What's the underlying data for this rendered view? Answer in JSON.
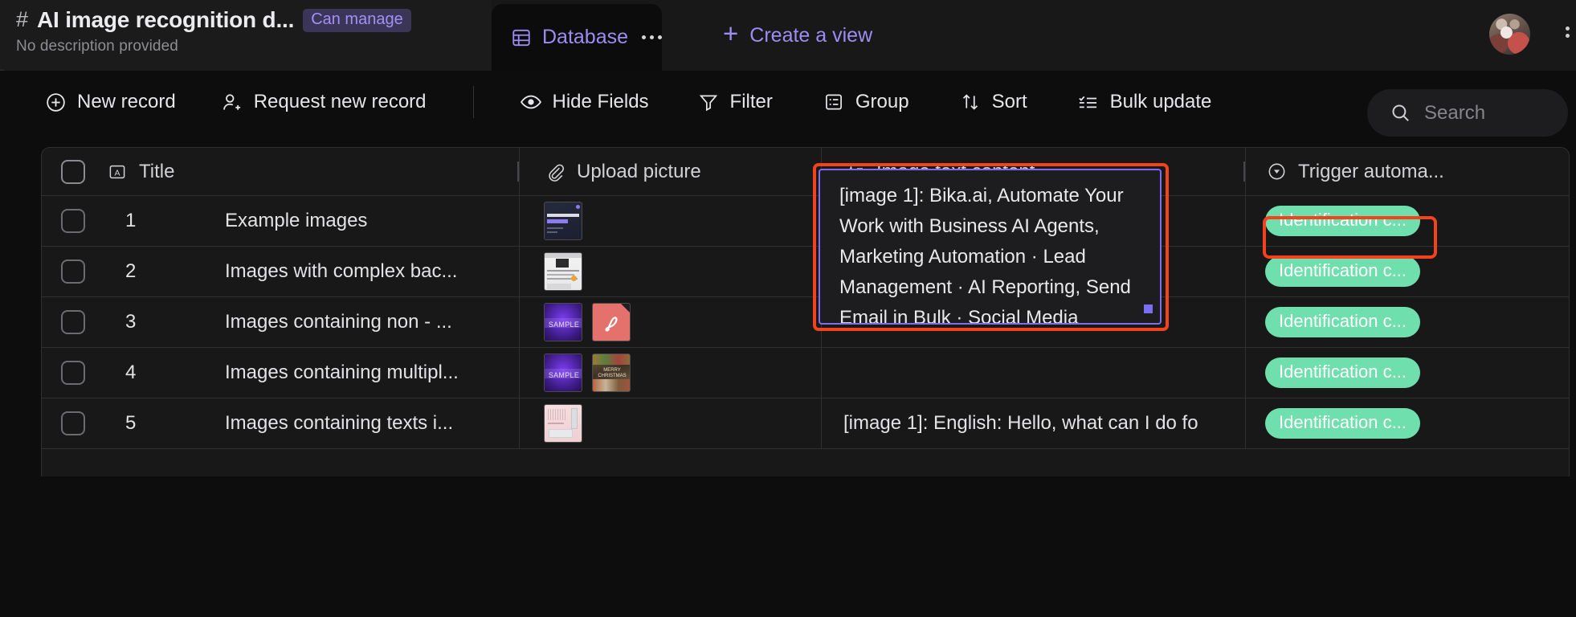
{
  "header": {
    "hash_icon": "hash-icon",
    "title": "AI image recognition d...",
    "permission_badge": "Can manage",
    "description": "No description provided",
    "tab": {
      "label": "Database",
      "icon": "table-icon",
      "more_icon": "ellipsis-icon"
    },
    "create_view": {
      "label": "Create a view",
      "icon": "plus-icon"
    },
    "avatar": "user-avatar",
    "overflow_icon": "vertical-ellipsis-icon"
  },
  "toolbar": {
    "buttons": [
      {
        "label": "New record",
        "icon": "plus-circle-icon"
      },
      {
        "label": "Request new record",
        "icon": "person-add-icon"
      },
      {
        "label": "Hide Fields",
        "icon": "eye-icon"
      },
      {
        "label": "Filter",
        "icon": "funnel-icon"
      },
      {
        "label": "Group",
        "icon": "group-icon"
      },
      {
        "label": "Sort",
        "icon": "sort-arrows-icon"
      },
      {
        "label": "Bulk update",
        "icon": "checklist-icon"
      }
    ],
    "search": {
      "placeholder": "Search",
      "icon": "search-icon"
    }
  },
  "grid": {
    "columns": [
      {
        "key": "title",
        "label": "Title",
        "icon": "text-field-icon"
      },
      {
        "key": "picture",
        "label": "Upload picture",
        "icon": "attachment-icon"
      },
      {
        "key": "text",
        "label": "Image text content",
        "icon": "long-text-icon"
      },
      {
        "key": "trigger",
        "label": "Trigger automa...",
        "icon": "select-circle-icon"
      }
    ],
    "rows": [
      {
        "index": "1",
        "title": "Example images",
        "text": "[image 1]: Bika.ai, Automate Your",
        "trigger": "Identification c...",
        "thumbs": [
          "bika-dark-banner"
        ]
      },
      {
        "index": "2",
        "title": "Images with complex bac...",
        "text": "",
        "trigger": "Identification c...",
        "thumbs": [
          "white-document-photo"
        ]
      },
      {
        "index": "3",
        "title": "Images containing non - ...",
        "text": "",
        "trigger": "Identification c...",
        "thumbs": [
          "sample-purple-banner",
          "pdf-file-icon"
        ]
      },
      {
        "index": "4",
        "title": "Images containing multipl...",
        "text": "",
        "trigger": "Identification c...",
        "thumbs": [
          "sample-purple-banner",
          "merry-christmas-photo"
        ]
      },
      {
        "index": "5",
        "title": "Images containing texts i...",
        "text": "[image 1]: English: Hello, what can I do fo",
        "trigger": "Identification c...",
        "thumbs": [
          "pink-chart-photo"
        ]
      }
    ]
  },
  "expanded_cell": {
    "text": "[image 1]: Bika.ai, Automate Your Work with Business AI Agents, Marketing Automation · Lead Management · AI Reporting, Send Email in Bulk · Social Media",
    "resize_handle": "resize-handle"
  },
  "annotations": [
    {
      "name": "highlight-image-text-cell"
    },
    {
      "name": "highlight-trigger-badge"
    }
  ],
  "colors": {
    "accent_purple": "#9d8df2",
    "badge_green": "#6fdfad",
    "annotation_red": "#f4421d",
    "selection_border": "#7b6ef0",
    "background": "#0d0d0e"
  }
}
